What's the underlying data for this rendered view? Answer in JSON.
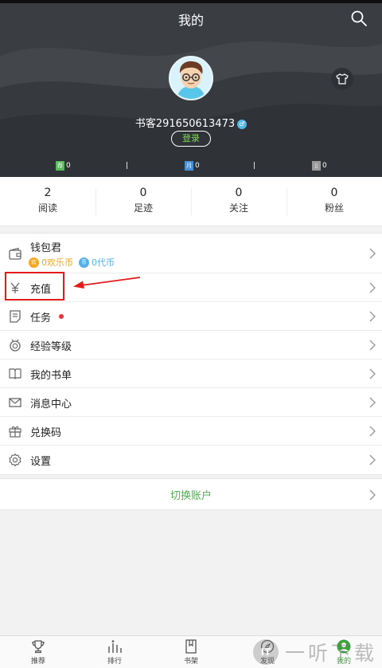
{
  "header": {
    "title": "我的",
    "username": "书客291650613473",
    "login_label": "登录",
    "badges": [
      {
        "icon": "recommend-badge-icon",
        "chip": "荐",
        "value": "0",
        "color": "#5cb85c"
      },
      {
        "icon": "monthly-badge-icon",
        "chip": "月",
        "value": "0",
        "color": "#4a8fd4"
      },
      {
        "icon": "ticket-badge-icon",
        "chip": "▯",
        "value": "0",
        "color": "#9a9a9a"
      }
    ]
  },
  "stats": [
    {
      "num": "2",
      "label": "阅读"
    },
    {
      "num": "0",
      "label": "足迹"
    },
    {
      "num": "0",
      "label": "关注"
    },
    {
      "num": "0",
      "label": "粉丝"
    }
  ],
  "wallet": {
    "label": "钱包君",
    "happy_coin": "0欢乐币",
    "happy_coin_chip": "欢",
    "happy_coin_color": "#f5a623",
    "voucher": "0代币",
    "voucher_chip": "币",
    "voucher_color": "#5aaee8"
  },
  "menu": [
    {
      "label": "充值",
      "icon": "yuan-icon"
    },
    {
      "label": "任务",
      "icon": "task-icon",
      "dot": true
    },
    {
      "label": "经验等级",
      "icon": "medal-icon"
    },
    {
      "label": "我的书单",
      "icon": "booklist-icon"
    },
    {
      "label": "消息中心",
      "icon": "mail-icon"
    },
    {
      "label": "兑换码",
      "icon": "gift-icon"
    },
    {
      "label": "设置",
      "icon": "gear-icon"
    }
  ],
  "switch_account": "切换账户",
  "bottom_nav": [
    {
      "label": "推荐",
      "icon": "trophy-icon",
      "active": false
    },
    {
      "label": "排行",
      "icon": "ranking-icon",
      "active": false
    },
    {
      "label": "书架",
      "icon": "bookshelf-icon",
      "active": false
    },
    {
      "label": "发现",
      "icon": "discover-icon",
      "active": false
    },
    {
      "label": "我的",
      "icon": "profile-icon",
      "active": true
    }
  ],
  "watermark": {
    "logo": "IT",
    "text": "一听下载"
  },
  "colors": {
    "accent_green": "#3ba53b",
    "header_bg": "#3a3d42",
    "annotation_red": "#e31b1b"
  }
}
